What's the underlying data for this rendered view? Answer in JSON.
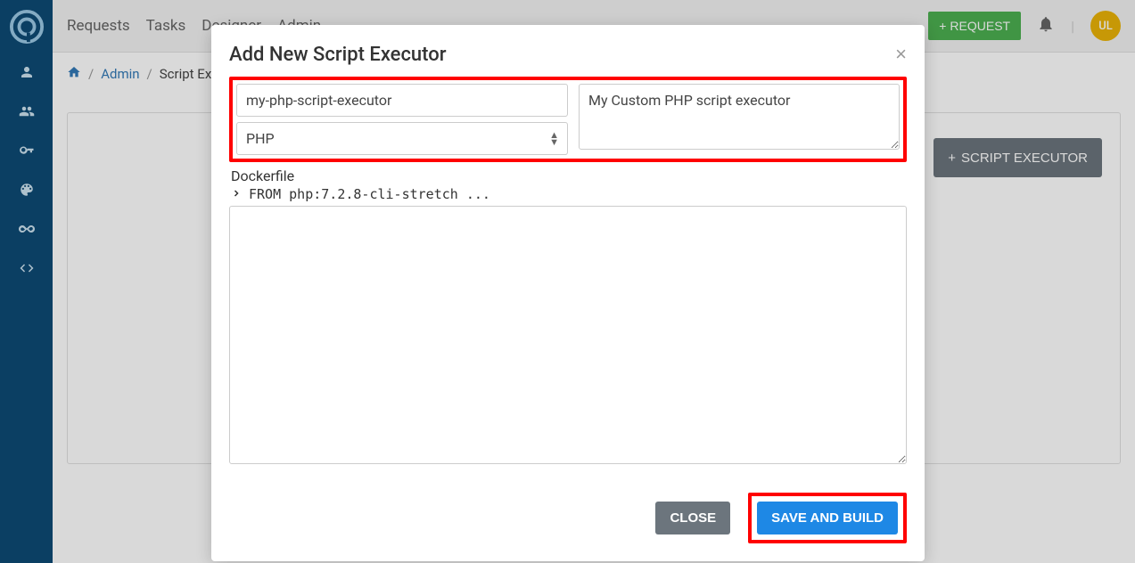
{
  "nav": {
    "links": [
      "Requests",
      "Tasks",
      "Designer",
      "Admin"
    ],
    "request_btn": "REQUEST",
    "avatar": "UL"
  },
  "breadcrumb": {
    "admin": "Admin",
    "current": "Script Executors"
  },
  "content": {
    "script_executor_btn": "SCRIPT EXECUTOR"
  },
  "modal": {
    "title": "Add New Script Executor",
    "name_value": "my-php-script-executor",
    "lang_value": "PHP",
    "desc_value": "My Custom PHP script executor",
    "dockerfile_label": "Dockerfile",
    "dockerfile_line": "FROM php:7.2.8-cli-stretch ...",
    "close_btn": "CLOSE",
    "save_btn": "SAVE AND BUILD",
    "close_x": "×"
  }
}
